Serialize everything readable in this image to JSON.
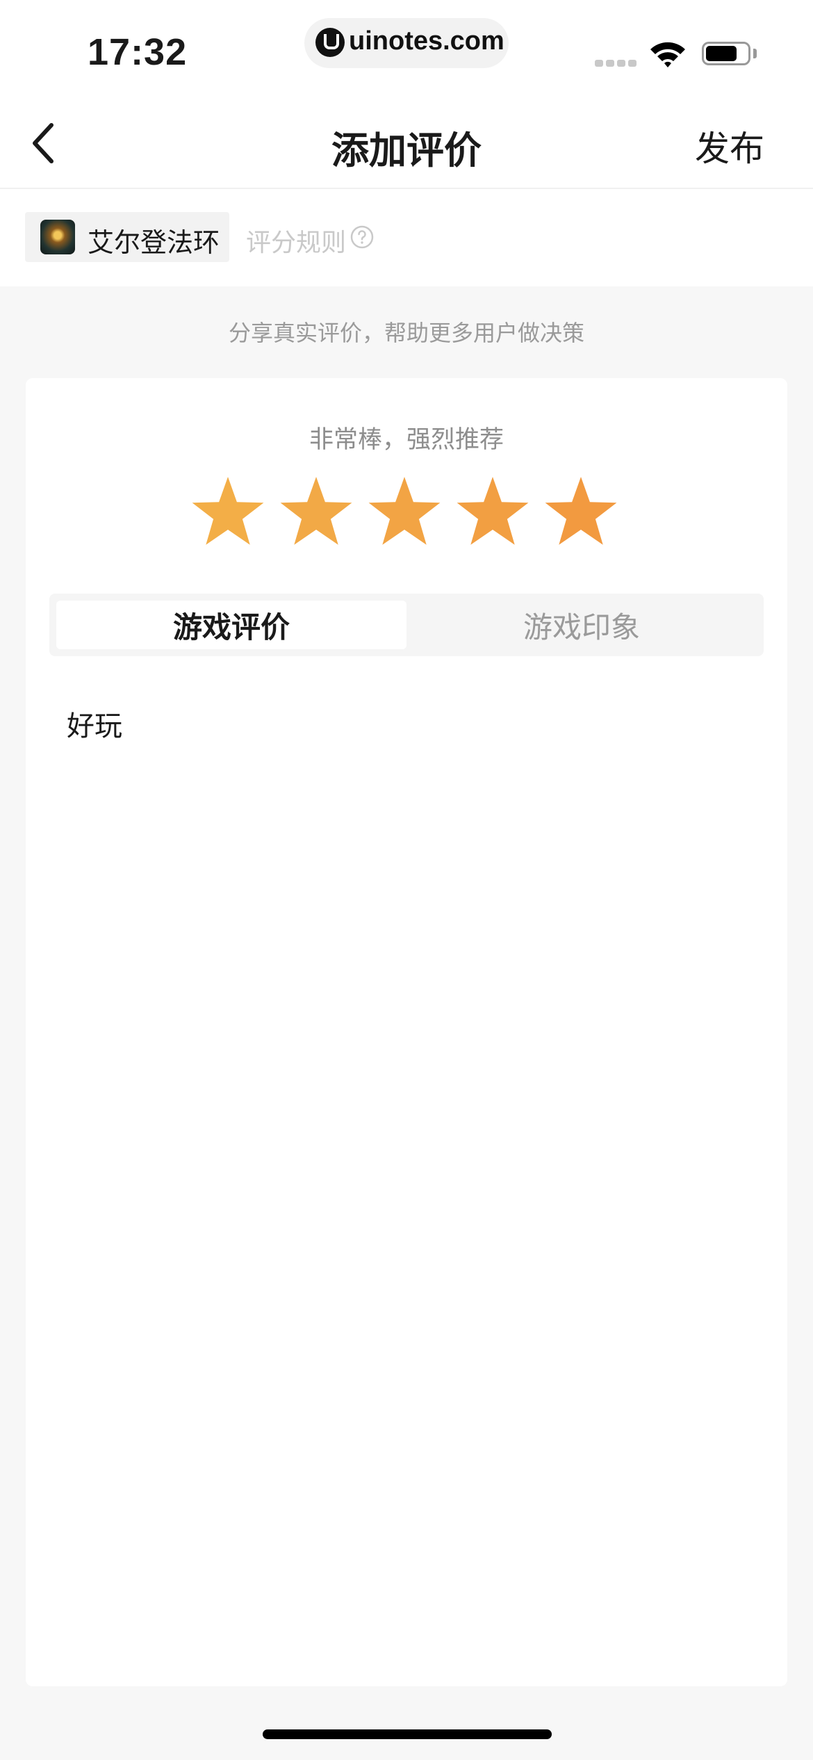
{
  "status_bar": {
    "time": "17:32",
    "url": "uinotes.com"
  },
  "nav": {
    "title": "添加评价",
    "publish_label": "发布"
  },
  "game": {
    "name": "艾尔登法环",
    "rules_label": "评分规则"
  },
  "hint": "分享真实评价，帮助更多用户做决策",
  "rating": {
    "label": "非常棒，强烈推荐",
    "value": 5,
    "max": 5,
    "star_colors": [
      "#F3AE47",
      "#F2A946",
      "#F2A444",
      "#F29F42",
      "#F29A40"
    ]
  },
  "tabs": [
    {
      "label": "游戏评价",
      "active": true
    },
    {
      "label": "游戏印象",
      "active": false
    }
  ],
  "review": {
    "text": "好玩"
  },
  "colors": {
    "star": "#F2A444",
    "background": "#F7F7F7"
  }
}
